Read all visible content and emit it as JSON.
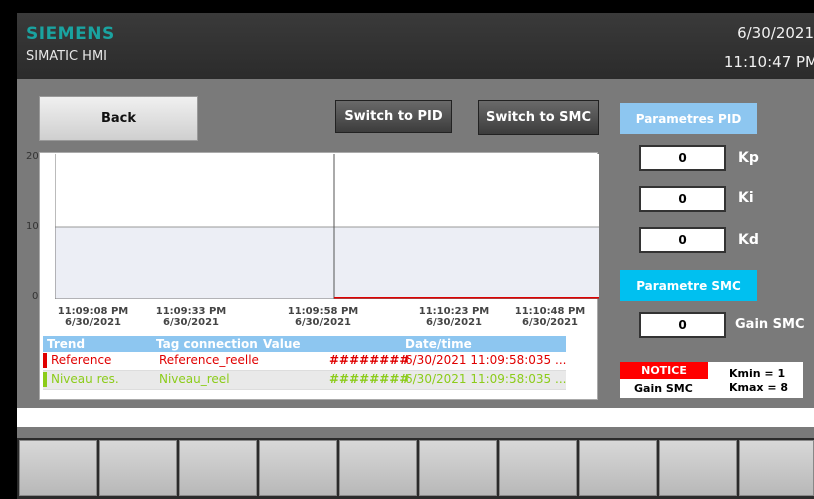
{
  "header": {
    "brand": "SIEMENS",
    "product": "SIMATIC HMI",
    "date": "6/30/2021",
    "time": "11:10:47 PM"
  },
  "buttons": {
    "back": "Back",
    "switch_pid": "Switch to PID",
    "switch_smc": "Switch to SMC"
  },
  "trend": {
    "y_ticks": [
      "20",
      "10",
      "0"
    ],
    "x_ticks": [
      {
        "time": "11:09:08 PM",
        "date": "6/30/2021"
      },
      {
        "time": "11:09:33 PM",
        "date": "6/30/2021"
      },
      {
        "time": "11:09:58 PM",
        "date": "6/30/2021"
      },
      {
        "time": "11:10:23 PM",
        "date": "6/30/2021"
      },
      {
        "time": "11:10:48 PM",
        "date": "6/30/2021"
      }
    ],
    "table": {
      "headers": [
        "Trend",
        "Tag connection",
        "Value",
        "Date/time"
      ],
      "rows": [
        {
          "trend": "Reference",
          "tag": "Reference_reelle",
          "value": "########",
          "datetime": "6/30/2021 11:09:58:035 ...",
          "color": "#e00000"
        },
        {
          "trend": "Niveau res.",
          "tag": "Niveau_reel",
          "value": "########",
          "datetime": "6/30/2021 11:09:58:035 ...",
          "color": "#8ccc1a"
        }
      ]
    }
  },
  "pid": {
    "title": "Parametres PID",
    "kp_label": "Kp",
    "kp_value": "0",
    "ki_label": "Ki",
    "ki_value": "0",
    "kd_label": "Kd",
    "kd_value": "0"
  },
  "smc": {
    "title": "Parametre SMC",
    "gain_label": "Gain SMC",
    "gain_value": "0"
  },
  "notice": {
    "badge": "NOTICE",
    "label": "Gain SMC",
    "kmin": "Kmin = 1",
    "kmax": "Kmax = 8"
  },
  "colors": {
    "brand": "#1aa3a0",
    "pid_title_bg": "#8dc6f0",
    "smc_title_bg": "#00c0f0",
    "notice_red": "#ff0000"
  }
}
